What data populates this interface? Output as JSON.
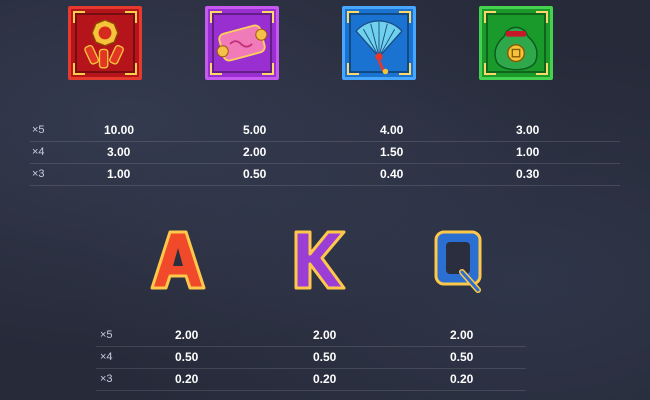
{
  "top_symbols": [
    {
      "name": "firecrackers",
      "color": "#b5141a"
    },
    {
      "name": "scroll",
      "color": "#9a2fd1"
    },
    {
      "name": "fan",
      "color": "#1a73d0"
    },
    {
      "name": "money-bag",
      "color": "#1a9a2a"
    }
  ],
  "top_paytable": {
    "multipliers": [
      "×5",
      "×4",
      "×3"
    ],
    "columns": [
      [
        "10.00",
        "3.00",
        "1.00"
      ],
      [
        "5.00",
        "2.00",
        "0.50"
      ],
      [
        "4.00",
        "1.50",
        "0.40"
      ],
      [
        "3.00",
        "1.00",
        "0.30"
      ]
    ]
  },
  "letter_symbols": [
    {
      "label": "A",
      "color": "#e8372a"
    },
    {
      "label": "K",
      "color": "#9b3ed6"
    },
    {
      "label": "Q",
      "color": "#2a6fd1"
    }
  ],
  "bottom_paytable": {
    "multipliers": [
      "×5",
      "×4",
      "×3"
    ],
    "columns": [
      [
        "2.00",
        "0.50",
        "0.20"
      ],
      [
        "2.00",
        "0.50",
        "0.20"
      ],
      [
        "2.00",
        "0.50",
        "0.20"
      ]
    ]
  }
}
